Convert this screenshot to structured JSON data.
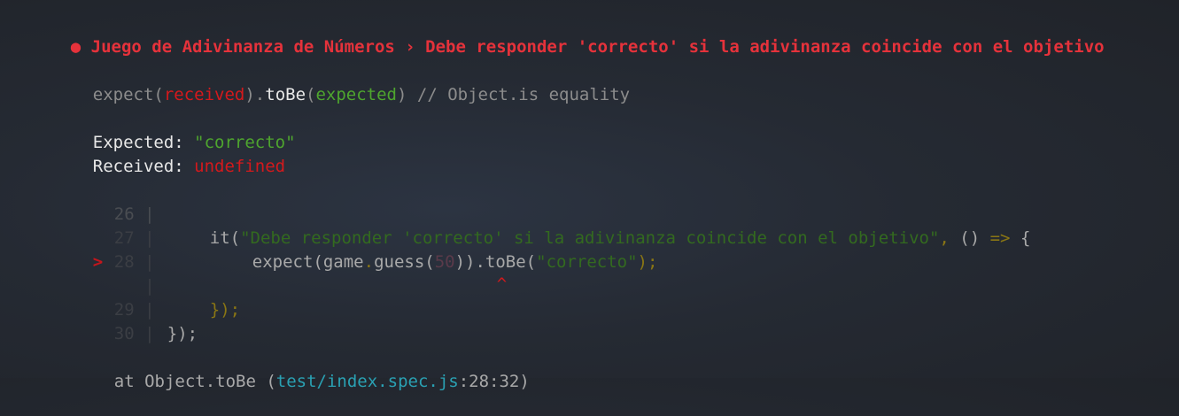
{
  "test": {
    "bullet": "●",
    "title": "Juego de Adivinanza de Números › Debe responder 'correcto' si la adivinanza coincide con el objetivo"
  },
  "matcher": {
    "expect_open": "expect(",
    "received": "received",
    "close_dot": ").",
    "to_be": "toBe",
    "paren_open": "(",
    "expected": "expected",
    "paren_close": ")",
    "comment": " // Object.is equality"
  },
  "comparison": {
    "expected_label": "Expected: ",
    "expected_value": "\"correcto\"",
    "received_label": "Received: ",
    "received_value": "undefined"
  },
  "code_frame": {
    "line_26": {
      "number": "26",
      "gutter": " |"
    },
    "line_27": {
      "number": "27",
      "gutter": " |",
      "it_fn": "it(",
      "test_name": "\"Debe responder 'correcto' si la adivinanza coincide con el objetivo\"",
      "comma": ", ",
      "params": "() ",
      "arrow": "=>",
      "brace": " {"
    },
    "line_28": {
      "marker": ">",
      "number": "28",
      "gutter": " |",
      "expect_open": "expect(",
      "game": "game",
      "dot": ".",
      "guess_open": "guess(",
      "argument": "50",
      "guess_close": "))",
      "to_be": ".toBe(",
      "value": "\"correcto\"",
      "close": ");"
    },
    "caret": {
      "gutter": " |",
      "symbol": "^"
    },
    "line_29": {
      "number": "29",
      "gutter": " |",
      "close": "});"
    },
    "line_30": {
      "number": "30",
      "gutter": " |",
      "close": "});"
    }
  },
  "stack": {
    "prefix": "at Object.toBe (",
    "file": "test/index.spec.js",
    "location": ":28:32",
    "suffix": ")"
  }
}
